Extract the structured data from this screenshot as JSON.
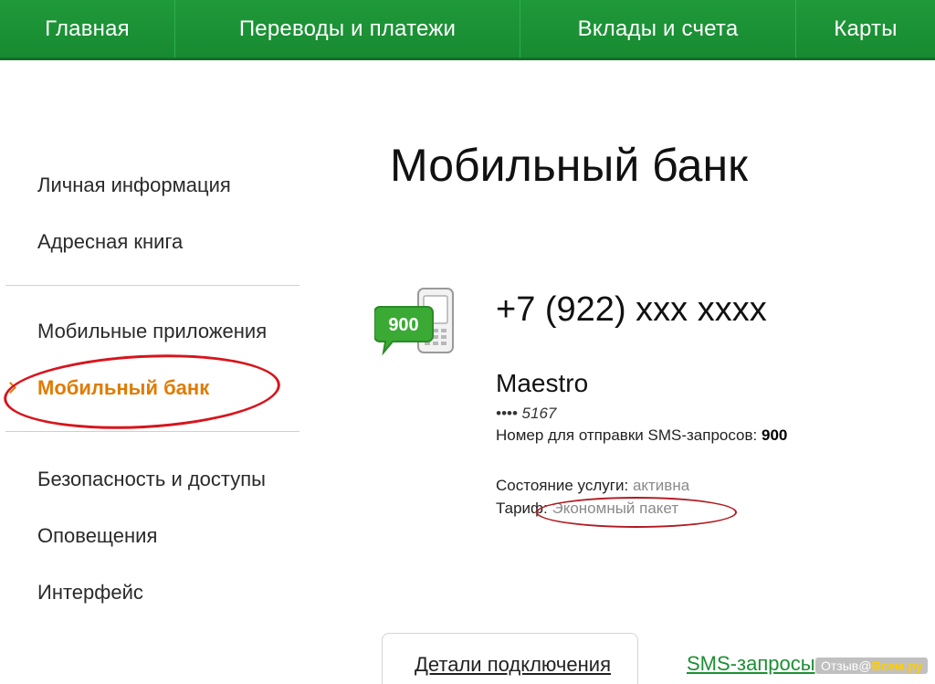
{
  "nav": {
    "items": [
      {
        "label": "Главная"
      },
      {
        "label": "Переводы и платежи"
      },
      {
        "label": "Вклады и счета"
      },
      {
        "label": "Карты"
      }
    ]
  },
  "sidebar": {
    "items": [
      {
        "label": "Личная информация"
      },
      {
        "label": "Адресная книга"
      },
      {
        "label": "Мобильные приложения"
      },
      {
        "label": "Мобильный банк",
        "active": true
      },
      {
        "label": "Безопасность и доступы"
      },
      {
        "label": "Оповещения"
      },
      {
        "label": "Интерфейс"
      }
    ]
  },
  "main": {
    "title": "Мобильный банк",
    "icon_badge": "900",
    "phone": "+7 (922) xxx xxxx",
    "card_name": "Maestro",
    "card_digits": "•••• 5167",
    "sms_label": "Номер для отправки SMS-запросов:",
    "sms_number": "900",
    "status_label": "Состояние услуги:",
    "status_value": "активна",
    "tariff_label": "Тариф:",
    "tariff_value": "Экономный пакет"
  },
  "tabs": {
    "details": "Детали подключения",
    "sms": "SMS-запросы"
  },
  "watermark": {
    "prefix": "Отзыв@",
    "brand": "Всем.ру"
  },
  "colors": {
    "nav_green": "#1f9a3a",
    "active_orange": "#e07b00",
    "annotation_red": "#d8141c",
    "link_green": "#1d8f34"
  }
}
